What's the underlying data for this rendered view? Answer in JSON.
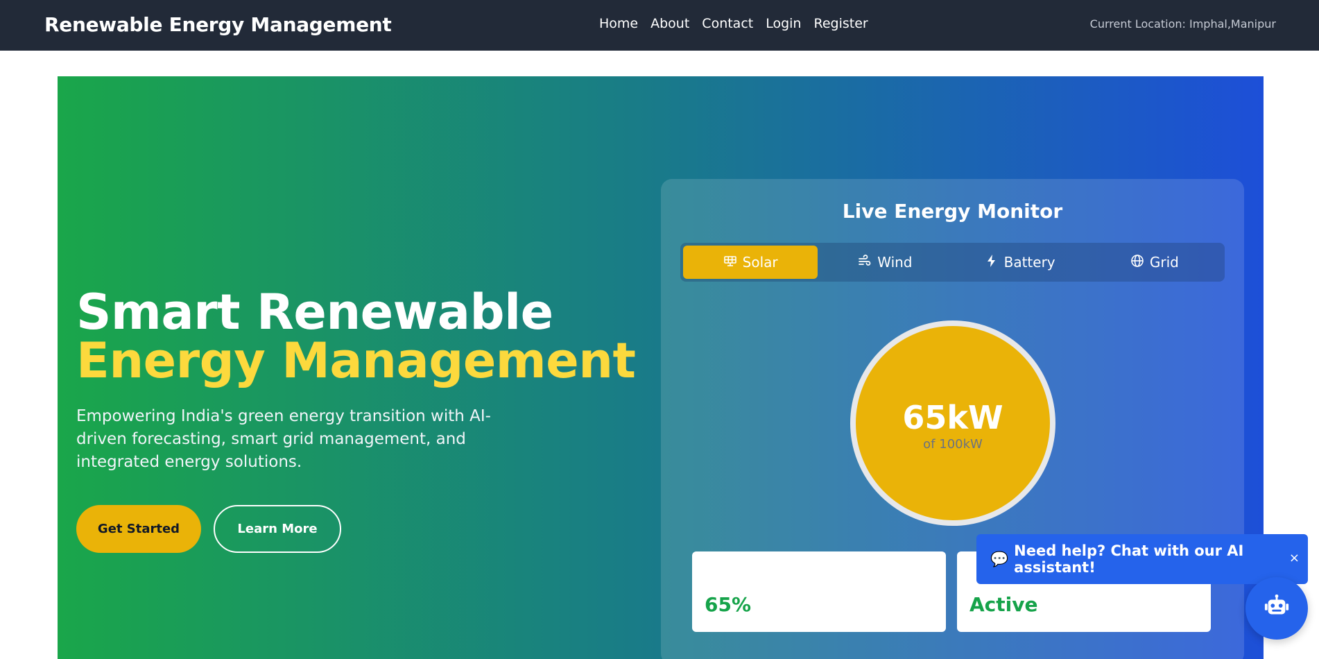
{
  "header": {
    "brand": "Renewable Energy Management",
    "nav": [
      {
        "label": "Home"
      },
      {
        "label": "About"
      },
      {
        "label": "Contact"
      },
      {
        "label": "Login"
      },
      {
        "label": "Register"
      }
    ],
    "location": "Current Location: Imphal,Manipur"
  },
  "hero": {
    "title_line1": "Smart Renewable",
    "title_line2": "Energy Management",
    "subtitle": "Empowering India's green energy transition with AI-driven forecasting, smart grid management, and integrated energy solutions.",
    "primary_button": "Get Started",
    "secondary_button": "Learn More"
  },
  "monitor": {
    "title": "Live Energy Monitor",
    "tabs": [
      {
        "label": "Solar",
        "icon": "solar-panel-icon",
        "active": true
      },
      {
        "label": "Wind",
        "icon": "wind-icon",
        "active": false
      },
      {
        "label": "Battery",
        "icon": "bolt-icon",
        "active": false
      },
      {
        "label": "Grid",
        "icon": "globe-icon",
        "active": false
      }
    ],
    "gauge_value": "65kW",
    "gauge_sub": "of 100kW",
    "cards": [
      {
        "value": "65%"
      },
      {
        "value": "Active"
      }
    ]
  },
  "chat": {
    "emoji": "💬",
    "message": "Need help? Chat with our AI assistant!",
    "close": "×"
  },
  "colors": {
    "accent": "#eab308",
    "nav_bg": "#222a38",
    "chat_blue": "#2563eb",
    "success": "#16a34a"
  }
}
